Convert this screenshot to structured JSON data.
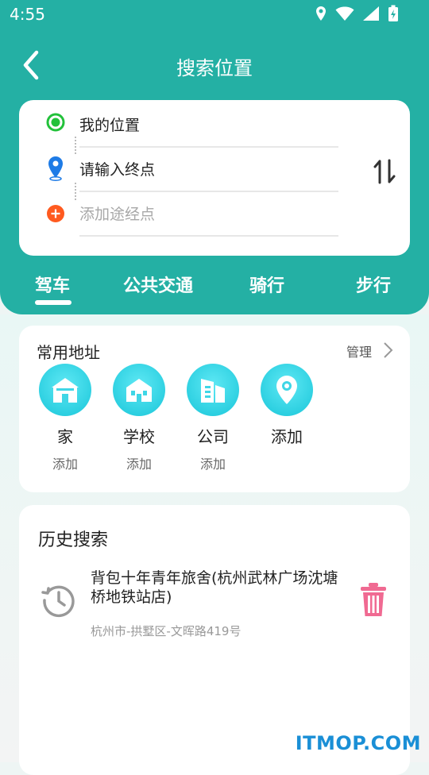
{
  "status_bar": {
    "time": "4:55",
    "icons": [
      "location-icon",
      "wifi-icon",
      "signal-icon",
      "battery-icon"
    ]
  },
  "header": {
    "title": "搜索位置",
    "back_icon": "back-arrow-icon"
  },
  "route": {
    "origin": "我的位置",
    "destination_placeholder": "请输入终点",
    "waypoint_placeholder": "添加途经点",
    "swap_icon": "swap-vertical-icon"
  },
  "modes": {
    "items": [
      "驾车",
      "公共交通",
      "骑行",
      "步行"
    ],
    "selected": "驾车"
  },
  "frequent": {
    "title": "常用地址",
    "manage": "管理",
    "items": [
      {
        "label": "家",
        "sub": "添加",
        "icon": "home-icon"
      },
      {
        "label": "学校",
        "sub": "添加",
        "icon": "school-icon"
      },
      {
        "label": "公司",
        "sub": "添加",
        "icon": "office-building-icon"
      },
      {
        "label": "添加",
        "sub": "",
        "icon": "location-pin-icon"
      }
    ]
  },
  "history": {
    "title": "历史搜索",
    "items": [
      {
        "name": "背包十年青年旅舍(杭州武林广场沈塘桥地铁站店)",
        "address": "杭州市-拱墅区-文晖路419号"
      }
    ]
  },
  "watermark": "ITMOP.COM",
  "colors": {
    "primary": "#24b0a4",
    "accent_cyan": "#19c6d9",
    "trash": "#f06a92",
    "pin_blue": "#1e7be6",
    "add_orange": "#ff5a1f",
    "origin_green": "#22c13a"
  }
}
